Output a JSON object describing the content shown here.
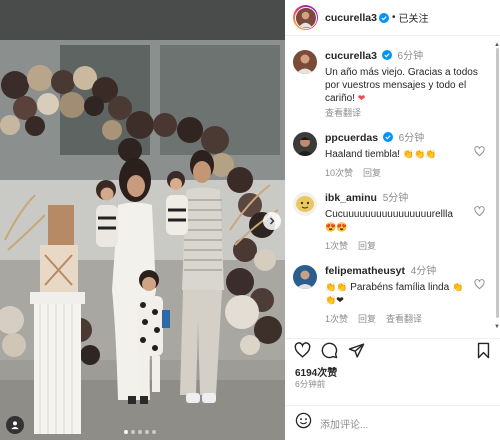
{
  "post": {
    "username": "cucurella3",
    "separator": "•",
    "follow_state": "已关注"
  },
  "caption": {
    "username": "cucurella3",
    "time": "6分钟",
    "text": "Un año más viejo. Gracias a todos por vuestros mensajes y todo el cariño!",
    "emoji": "❤",
    "see_translation": "查看翻译"
  },
  "comments": [
    {
      "username": "ppcuerdas",
      "verified": true,
      "time": "6分钟",
      "text": "Haaland tiembla!",
      "emoji": "👏👏👏",
      "likes": "10次赞",
      "reply": "回复"
    },
    {
      "username": "ibk_aminu",
      "verified": false,
      "time": "5分钟",
      "text": "Cucuuuuuuuuuuuuuuuurellla",
      "emoji": "😍😍",
      "likes": "1次赞",
      "reply": "回复"
    },
    {
      "username": "felipematheusyt",
      "verified": false,
      "time": "4分钟",
      "text_prefix": "👏👏",
      "text": " Parabéns família linda ",
      "emoji": "👏",
      "emoji2": "👏❤",
      "likes": "1次赞",
      "reply": "回复",
      "see_translation": "查看翻译"
    }
  ],
  "footer": {
    "likes": "6194次赞",
    "time_ago": "6分钟前",
    "comment_placeholder": "添加评论..."
  },
  "colors": {
    "verified_blue": "#0095f6",
    "heart_red": "#ed4956",
    "muted_gray": "#8e8e8e"
  },
  "icons": {
    "like": "heart-icon",
    "comment": "comment-bubble-icon",
    "share": "paper-plane-icon",
    "save": "bookmark-icon",
    "emoji": "smiley-icon",
    "more": "more-dots-icon",
    "next": "chevron-right-icon",
    "tagged": "person-tag-icon"
  }
}
